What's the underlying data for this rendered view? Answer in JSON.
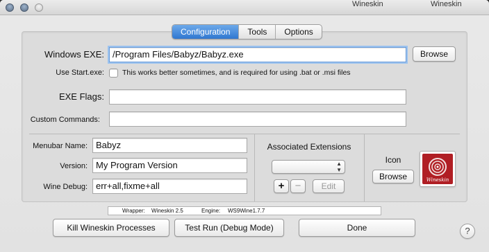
{
  "background_tabs": [
    "Wineskin",
    "Wineskin"
  ],
  "tabs": [
    {
      "label": "Configuration",
      "active": true
    },
    {
      "label": "Tools",
      "active": false
    },
    {
      "label": "Options",
      "active": false
    }
  ],
  "exe": {
    "label": "Windows EXE:",
    "value": "/Program Files/Babyz/Babyz.exe",
    "browse": "Browse"
  },
  "start_exe": {
    "label": "Use Start.exe:",
    "checked": false,
    "description": "This works better sometimes, and is required for using .bat or .msi files"
  },
  "exe_flags": {
    "label": "EXE Flags:",
    "value": ""
  },
  "custom_commands": {
    "label": "Custom Commands:",
    "value": ""
  },
  "menubar_name": {
    "label": "Menubar Name:",
    "value": "Babyz"
  },
  "version": {
    "label": "Version:",
    "value": "My Program Version"
  },
  "wine_debug": {
    "label": "Wine Debug:",
    "value": "err+all,fixme+all"
  },
  "extensions": {
    "title": "Associated Extensions",
    "selected": "",
    "add": "+",
    "remove": "−",
    "edit": "Edit"
  },
  "icon": {
    "label": "Icon",
    "browse": "Browse",
    "image_text": "Wineskin"
  },
  "status": {
    "wrapper_label": "Wrapper:",
    "wrapper_value": "Wineskin 2.5",
    "engine_label": "Engine:",
    "engine_value": "WS9Wine1.7.7"
  },
  "buttons": {
    "kill": "Kill Wineskin Processes",
    "test_run": "Test Run (Debug Mode)",
    "done": "Done",
    "help": "?"
  },
  "colors": {
    "accent": "#2f77d0",
    "icon_bg": "#b01e24"
  }
}
